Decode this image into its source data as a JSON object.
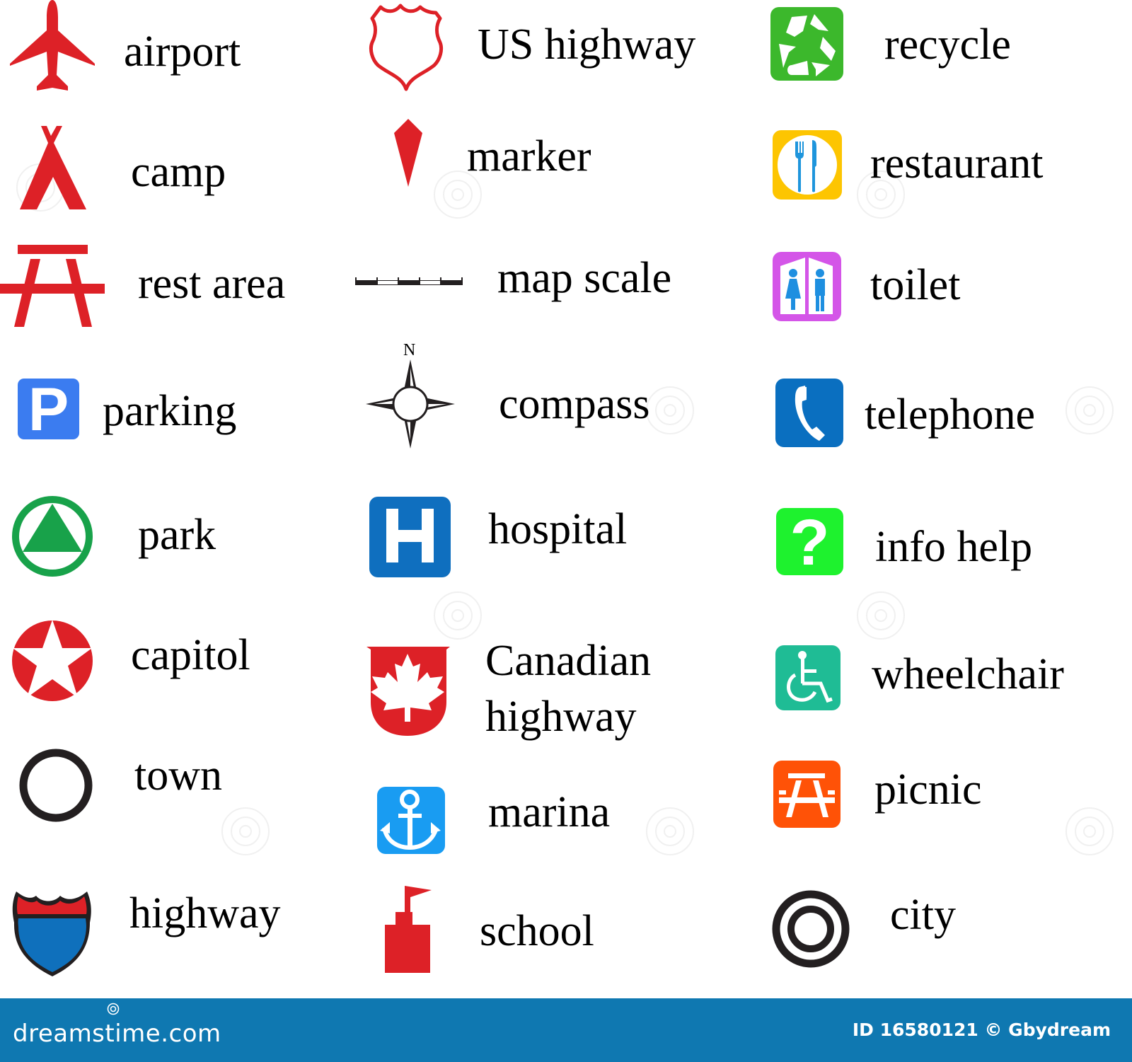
{
  "colors": {
    "red": "#dd2127",
    "black": "#231f20",
    "parking_blue": "#3b7cf0",
    "park_green": "#18a24a",
    "recycle_green": "#3cb82c",
    "restaurant_yellow": "#fdc501",
    "fork_knife_blue": "#1e95dc",
    "toilet_magenta": "#d455e8",
    "toilet_figure_blue": "#1e8fe0",
    "telephone_blue": "#0a6fc0",
    "hospital_blue": "#0f6fbf",
    "info_green": "#1ef22e",
    "wheelchair_teal": "#1fbc95",
    "picnic_orange": "#ff5207",
    "marina_blue": "#199cf2",
    "highway_blue": "#0f70bc",
    "footer_blue": "#0f78b1"
  },
  "legend": {
    "column1": [
      {
        "key": "airport",
        "label": "airport",
        "icon": "airplane-icon"
      },
      {
        "key": "camp",
        "label": "camp",
        "icon": "tent-icon"
      },
      {
        "key": "rest_area",
        "label": "rest area",
        "icon": "picnic-table-icon"
      },
      {
        "key": "parking",
        "label": "parking",
        "icon": "parking-icon",
        "glyph": "P"
      },
      {
        "key": "park",
        "label": "park",
        "icon": "triangle-in-circle-icon"
      },
      {
        "key": "capitol",
        "label": "capitol",
        "icon": "star-in-circle-icon"
      },
      {
        "key": "town",
        "label": "town",
        "icon": "ring-icon"
      },
      {
        "key": "highway",
        "label": "highway",
        "icon": "interstate-shield-icon"
      }
    ],
    "column2": [
      {
        "key": "us_highway",
        "label": "US highway",
        "icon": "us-shield-icon"
      },
      {
        "key": "marker",
        "label": "marker",
        "icon": "marker-pin-icon"
      },
      {
        "key": "map_scale",
        "label": "map scale",
        "icon": "scale-bar-icon"
      },
      {
        "key": "compass",
        "label": "compass",
        "icon": "compass-rose-icon",
        "glyph": "N"
      },
      {
        "key": "hospital",
        "label": "hospital",
        "icon": "hospital-icon",
        "glyph": "H"
      },
      {
        "key": "canadian_highway",
        "label": "Canadian\nhighway",
        "icon": "maple-leaf-shield-icon"
      },
      {
        "key": "marina",
        "label": "marina",
        "icon": "anchor-icon"
      },
      {
        "key": "school",
        "label": "school",
        "icon": "school-flag-icon"
      }
    ],
    "column3": [
      {
        "key": "recycle",
        "label": "recycle",
        "icon": "recycle-icon"
      },
      {
        "key": "restaurant",
        "label": "restaurant",
        "icon": "fork-knife-icon"
      },
      {
        "key": "toilet",
        "label": "toilet",
        "icon": "restroom-icon"
      },
      {
        "key": "telephone",
        "label": "telephone",
        "icon": "telephone-icon"
      },
      {
        "key": "info_help",
        "label": "info help",
        "icon": "question-mark-icon",
        "glyph": "?"
      },
      {
        "key": "wheelchair",
        "label": "wheelchair",
        "icon": "wheelchair-icon"
      },
      {
        "key": "picnic",
        "label": "picnic",
        "icon": "picnic-table-square-icon"
      },
      {
        "key": "city",
        "label": "city",
        "icon": "double-ring-icon"
      }
    ]
  },
  "footer": {
    "brand": "dreamstime.com",
    "credit": "ID 16580121 © Gbydream"
  }
}
